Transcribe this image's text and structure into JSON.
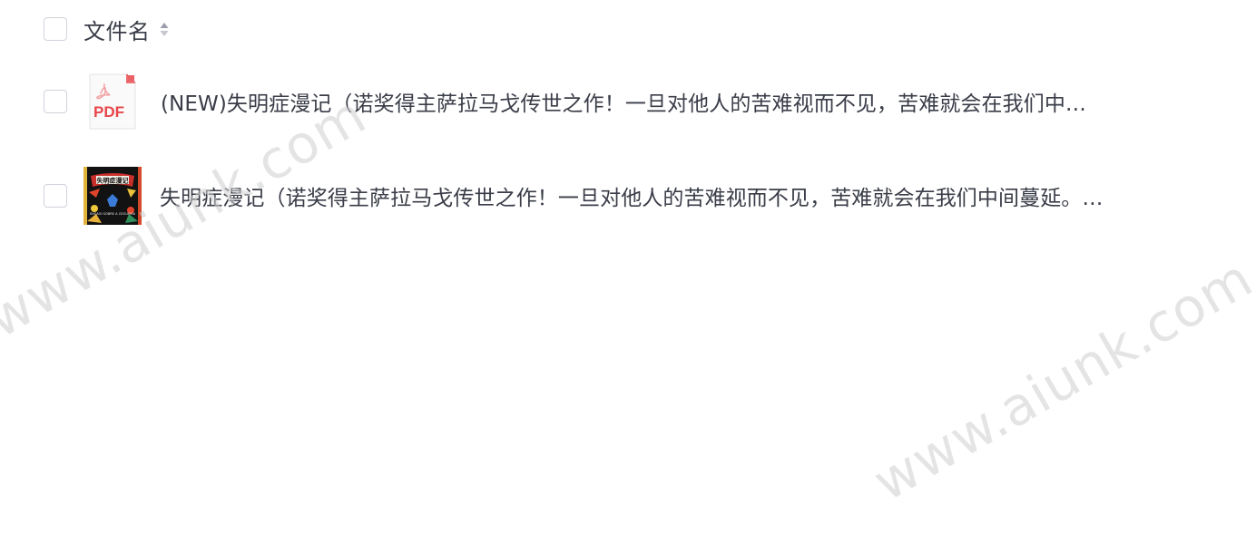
{
  "header": {
    "column_title": "文件名",
    "sort_icon": "sort-toggle-icon"
  },
  "files": [
    {
      "name": "(NEW)失明症漫记（诺奖得主萨拉马戈传世之作！一旦对他人的苦难视而不见，苦难就会在我们中…",
      "thumbnail": "pdf-file-icon",
      "thumbnail_label": "PDF"
    },
    {
      "name": "失明症漫记（诺奖得主萨拉马戈传世之作！一旦对他人的苦难视而不见，苦难就会在我们中间蔓延。…",
      "thumbnail": "book-cover-thumbnail",
      "cover_title": "失明症漫记",
      "cover_subtitle": "ENSAIO SOBRE A CEGUEIRA"
    }
  ],
  "watermark": {
    "text": "www.aiunk.com"
  },
  "colors": {
    "text": "#3a3d48",
    "checkbox_border": "#cfd3da",
    "pdf_red": "#e8464b",
    "watermark": "#cfcfcf"
  }
}
